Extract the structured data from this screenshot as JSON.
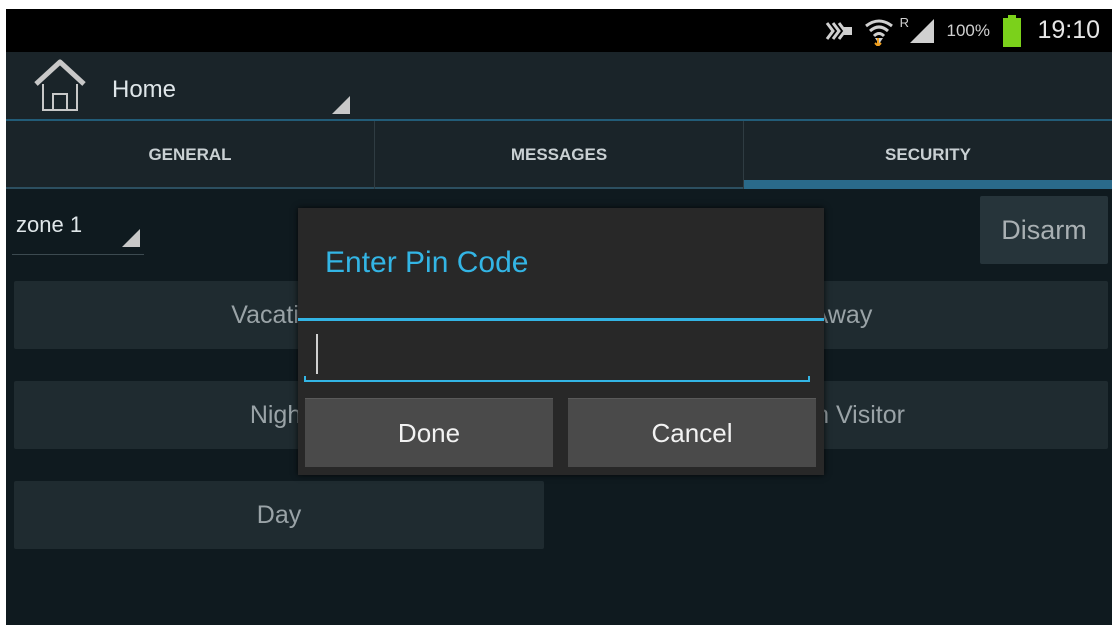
{
  "status_bar": {
    "time": "19:10",
    "battery_percent": "100%",
    "roaming_indicator": "R",
    "icons": [
      "nfc-icon",
      "wifi-icon",
      "signal-icon",
      "battery-icon"
    ],
    "battery_color": "#7bd11b",
    "wifi_arrow_color": "#f0a020"
  },
  "action_bar": {
    "icon": "home-icon",
    "title": "Home"
  },
  "tabs": [
    {
      "label": "GENERAL",
      "active": false
    },
    {
      "label": "MESSAGES",
      "active": false
    },
    {
      "label": "SECURITY",
      "active": true
    }
  ],
  "zone_selector": {
    "value": "zone 1"
  },
  "buttons": {
    "disarm": "Disarm",
    "vacation": "Vacation",
    "away": "Away",
    "night": "Night",
    "with_visitor": "With Visitor",
    "day": "Day"
  },
  "dialog": {
    "title": "Enter Pin Code",
    "pin_value": "",
    "done_label": "Done",
    "cancel_label": "Cancel"
  },
  "colors": {
    "accent": "#33b5e5",
    "background": "#0f1a1f"
  }
}
